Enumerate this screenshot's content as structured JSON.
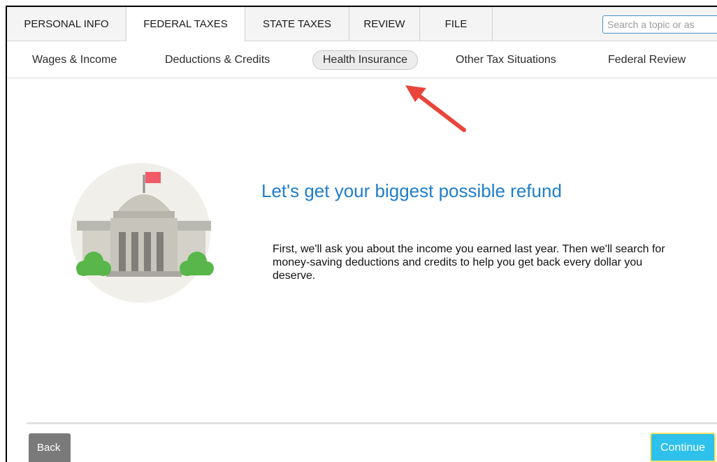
{
  "tabs": [
    {
      "label": "PERSONAL INFO"
    },
    {
      "label": "FEDERAL TAXES",
      "active": true
    },
    {
      "label": "STATE TAXES"
    },
    {
      "label": "REVIEW"
    },
    {
      "label": "FILE"
    }
  ],
  "search": {
    "placeholder": "Search a topic or as"
  },
  "subnav": [
    {
      "label": "Wages & Income"
    },
    {
      "label": "Deductions & Credits"
    },
    {
      "label": "Health Insurance",
      "active": true
    },
    {
      "label": "Other Tax Situations"
    },
    {
      "label": "Federal Review"
    }
  ],
  "main": {
    "headline": "Let's get your biggest possible refund",
    "body": "First, we'll ask you about the income you earned last year. Then we'll search for money-saving deductions and credits to help you get back every dollar you deserve."
  },
  "footer": {
    "back_label": "Back",
    "continue_label": "Continue"
  },
  "colors": {
    "accent_blue": "#1f7ecb",
    "continue_button": "#2ec1ec",
    "annotation_arrow": "#e8453c",
    "flag": "#ef5b66",
    "bush": "#59b64a"
  },
  "icons": {
    "illustration": "capitol-building-icon",
    "annotation": "red-arrow-icon"
  }
}
